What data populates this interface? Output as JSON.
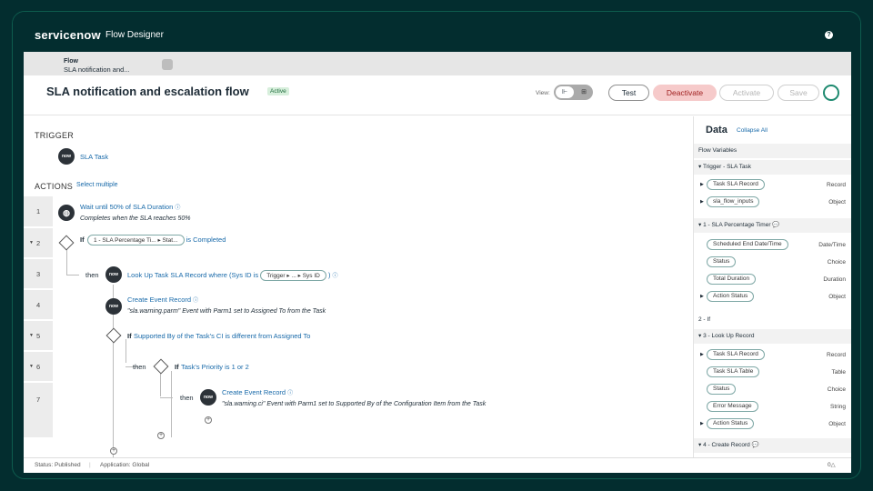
{
  "brand": {
    "logo": "servicenow",
    "app": "Flow Designer"
  },
  "tab": {
    "kind": "Flow",
    "name": "SLA notification and..."
  },
  "header": {
    "title": "SLA notification and escalation flow",
    "status": "Active",
    "view_label": "View:",
    "test": "Test",
    "deactivate": "Deactivate",
    "activate": "Activate",
    "save": "Save"
  },
  "trigger": {
    "heading": "TRIGGER",
    "name": "SLA Task"
  },
  "actions": {
    "heading": "ACTIONS",
    "select_multiple": "Select multiple"
  },
  "steps": [
    {
      "num": "1",
      "title": "Wait until 50% of SLA Duration",
      "desc": "Completes when the SLA reaches 50%"
    },
    {
      "num": "2",
      "if": "If",
      "pill": "1 - SLA Percentage Ti... ▸ Stat...",
      "cond": "is Completed"
    },
    {
      "num": "3",
      "then": "then",
      "title": "Look Up Task SLA Record where (Sys ID is",
      "pill": "Trigger ▸ ... ▸ Sys ID",
      "close": ")"
    },
    {
      "num": "4",
      "title": "Create Event Record",
      "desc": "\"sla.warning.parm\" Event with Parm1 set to Assigned To from the Task"
    },
    {
      "num": "5",
      "if": "If",
      "title": "Supported By of the Task's CI is different from Assigned To"
    },
    {
      "num": "6",
      "then": "then",
      "if": "If",
      "title": "Task's Priority is 1 or 2"
    },
    {
      "num": "7",
      "then": "then",
      "title": "Create Event Record",
      "desc": "\"sla.warning.ci\" Event with Parm1 set to Supported By of the Configuration Item from the Task"
    }
  ],
  "data_panel": {
    "title": "Data",
    "collapse": "Collapse All",
    "flow_vars": "Flow Variables",
    "groups": [
      {
        "label": "Trigger - SLA Task",
        "items": [
          {
            "name": "Task SLA Record",
            "type": "Record"
          },
          {
            "name": "sla_flow_inputs",
            "type": "Object"
          }
        ]
      },
      {
        "label": "1 - SLA Percentage Timer",
        "items": [
          {
            "name": "Scheduled End Date/Time",
            "type": "Date/Time"
          },
          {
            "name": "Status",
            "type": "Choice"
          },
          {
            "name": "Total Duration",
            "type": "Duration"
          },
          {
            "name": "Action Status",
            "type": "Object"
          }
        ]
      },
      {
        "label": "2 - If",
        "items": []
      },
      {
        "label": "3 - Look Up Record",
        "items": [
          {
            "name": "Task SLA Record",
            "type": "Record"
          },
          {
            "name": "Task SLA Table",
            "type": "Table"
          },
          {
            "name": "Status",
            "type": "Choice"
          },
          {
            "name": "Error Message",
            "type": "String"
          },
          {
            "name": "Action Status",
            "type": "Object"
          }
        ]
      },
      {
        "label": "4 - Create Record",
        "items": []
      }
    ]
  },
  "statusbar": {
    "status": "Status: Published",
    "application": "Application: Global",
    "count": "0"
  }
}
